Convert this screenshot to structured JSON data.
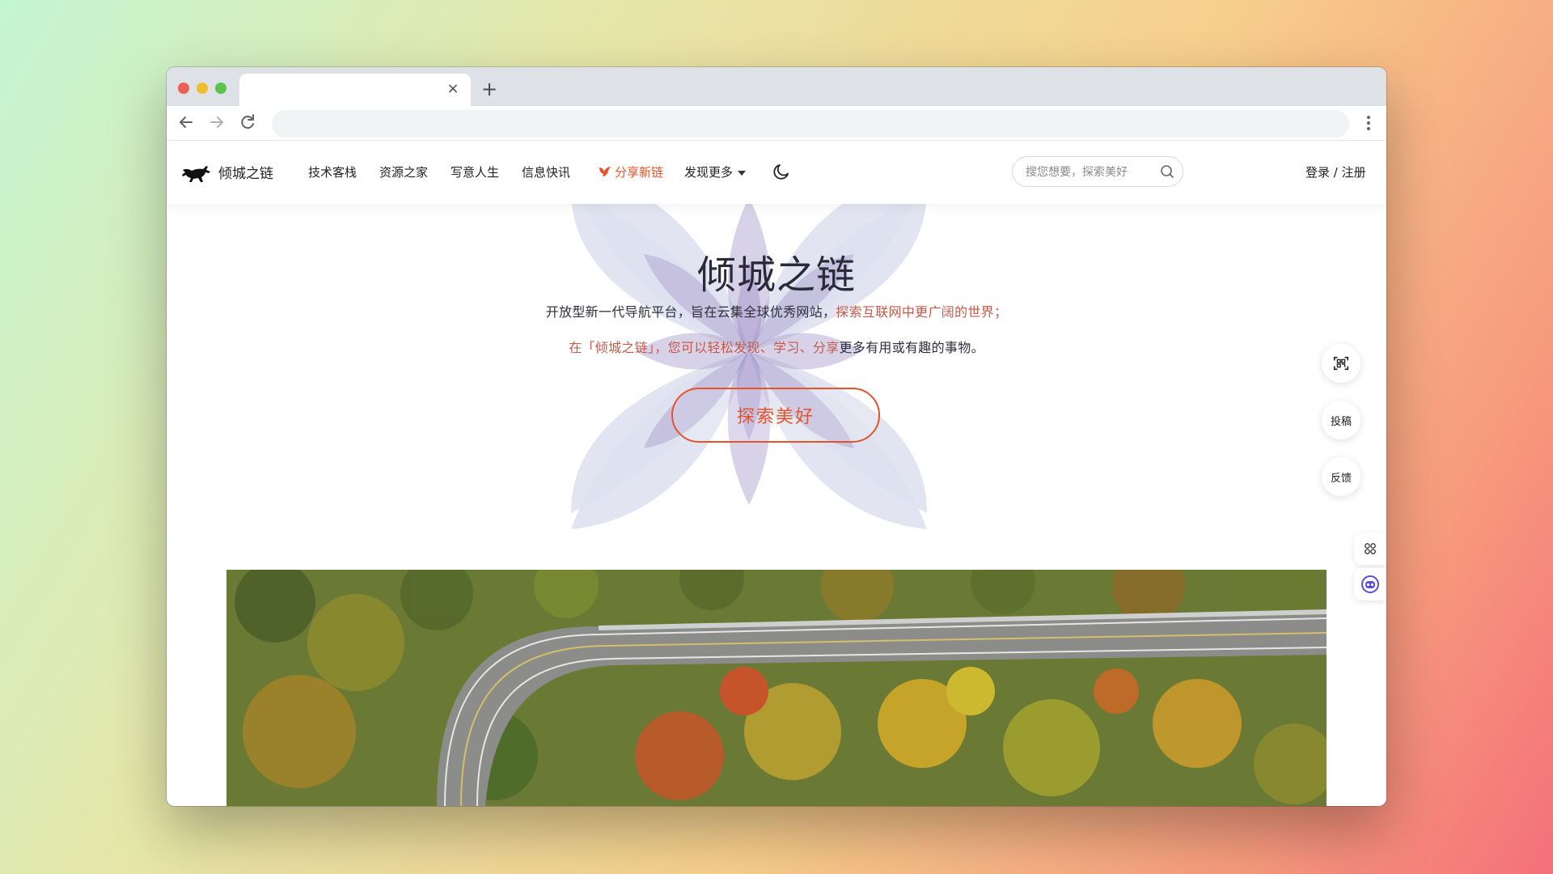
{
  "browser": {
    "tab_close": "×",
    "new_tab": "+",
    "menu": "⋮",
    "traffic_colors": {
      "close": "#ec5f57",
      "minimize": "#f1bd2f",
      "zoom": "#5dc14c"
    }
  },
  "header": {
    "brand": "倾城之链",
    "nav": [
      "技术客栈",
      "资源之家",
      "写意人生",
      "信息快讯"
    ],
    "highlight": "分享新链",
    "more": "发现更多",
    "search_placeholder": "搜您想要，探索美好",
    "auth_login": "登录",
    "auth_sep": " / ",
    "auth_register": "注册"
  },
  "hero": {
    "title": "倾城之链",
    "line1_a": "开放型新一代导航平台，旨在云集全球优秀网站，",
    "line1_b": "探索互联网中更广阔的世界；",
    "line2_a": "在「倾城之链」，您可以轻松发现、学习、分享",
    "line2_b": "更多有用或有趣的事物。",
    "cta": "探索美好"
  },
  "sidebar": {
    "submit": "投稿",
    "feedback": "反馈"
  },
  "colors": {
    "accent": "#e4542c",
    "text": "#2a2a3a"
  },
  "icons": [
    "horse-logo-icon",
    "bird-icon",
    "moon-icon",
    "search-icon",
    "qr-scan-icon",
    "grid-icon",
    "robot-icon"
  ]
}
